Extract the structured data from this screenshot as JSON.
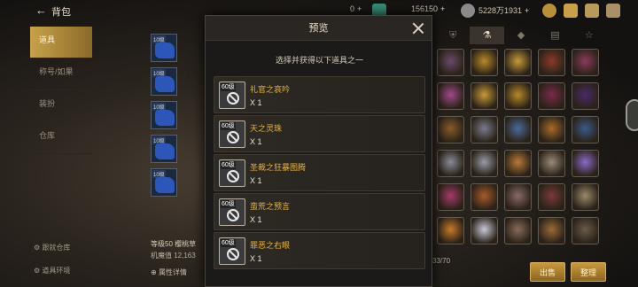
{
  "header": {
    "title": "背包",
    "currency_1": "0",
    "currency_2": "156150",
    "currency_3": "5228万1931"
  },
  "sidebar": {
    "items": [
      {
        "label": "道具"
      },
      {
        "label": "称号/如果"
      },
      {
        "label": "装扮"
      },
      {
        "label": "仓库"
      }
    ],
    "footer_1": "跟就仓库",
    "footer_2": "道具环境"
  },
  "character": {
    "level_text": "等级50 樱桃草",
    "power_text": "机魔值 12,163",
    "detail_button": "属性详情"
  },
  "inventory": {
    "count": "33/70",
    "btn_sell": "出售",
    "btn_stack": "整理"
  },
  "modal": {
    "title": "预览",
    "subtitle": "选择并获得以下道具之一",
    "items": [
      {
        "level": "60级",
        "name": "礼官之哀吟",
        "qty": "X 1"
      },
      {
        "level": "60级",
        "name": "天之灵珠",
        "qty": "X 1"
      },
      {
        "level": "60级",
        "name": "圣裁之狂暴图腾",
        "qty": "X 1"
      },
      {
        "level": "60级",
        "name": "蛮荒之预言",
        "qty": "X 1"
      },
      {
        "level": "60级",
        "name": "罪恶之右眼",
        "qty": "X 1"
      }
    ]
  },
  "left_slots": [
    {
      "level": "10级"
    },
    {
      "level": "10级"
    },
    {
      "level": "10级"
    },
    {
      "level": "10级"
    },
    {
      "level": "10级"
    }
  ],
  "colors": {
    "accent_gold": "#c8a24a",
    "item_name": "#e4b44a",
    "rarity_blue": "#2c57b8"
  }
}
